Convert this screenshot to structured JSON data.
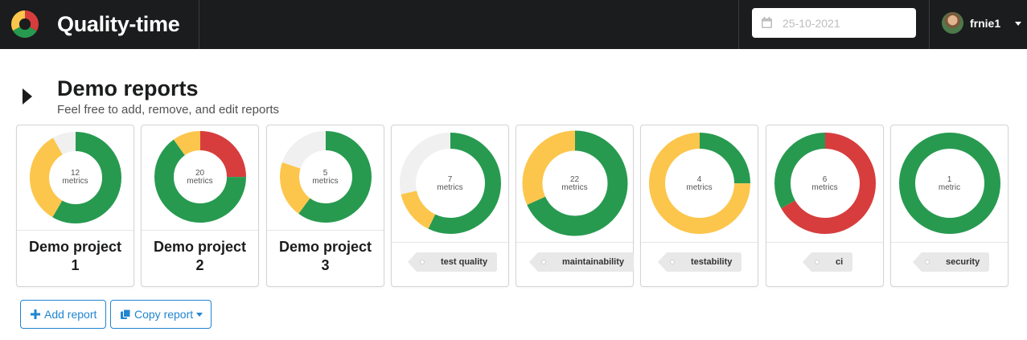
{
  "app": {
    "title": "Quality-time",
    "logo_icon": "quality-time-logo-icon"
  },
  "date_picker": {
    "value": "25-10-2021",
    "icon": "calendar-icon"
  },
  "user": {
    "name": "frnie1",
    "avatar_icon": "user-avatar",
    "caret_icon": "caret-down-icon"
  },
  "page": {
    "title": "Demo reports",
    "subtitle": "Feel free to add, remove, and edit reports",
    "collapse_icon": "caret-right-icon"
  },
  "colors": {
    "green": "#279a50",
    "yellow": "#fcc64c",
    "red": "#d73d3d",
    "grey": "#f0f0f0",
    "link_blue": "#2185d0",
    "topbar": "#1b1c1d"
  },
  "reports": [
    {
      "name_line1": "Demo project",
      "name_line2": "1",
      "metrics_count": "12",
      "metrics_label": "metrics",
      "segments": [
        {
          "status": "green",
          "count": 7
        },
        {
          "status": "yellow",
          "count": 4
        },
        {
          "status": "grey",
          "count": 1
        }
      ]
    },
    {
      "name_line1": "Demo project",
      "name_line2": "2",
      "metrics_count": "20",
      "metrics_label": "metrics",
      "segments": [
        {
          "status": "red",
          "count": 5
        },
        {
          "status": "green",
          "count": 13
        },
        {
          "status": "yellow",
          "count": 2
        }
      ]
    },
    {
      "name_line1": "Demo project",
      "name_line2": "3",
      "metrics_count": "5",
      "metrics_label": "metrics",
      "segments": [
        {
          "status": "green",
          "count": 3
        },
        {
          "status": "yellow",
          "count": 1
        },
        {
          "status": "grey",
          "count": 1
        }
      ]
    }
  ],
  "tags": [
    {
      "label": "test quality",
      "metrics_count": "7",
      "metrics_label": "metrics",
      "segments": [
        {
          "status": "green",
          "count": 4
        },
        {
          "status": "yellow",
          "count": 1
        },
        {
          "status": "grey",
          "count": 2
        }
      ]
    },
    {
      "label": "maintainability",
      "metrics_count": "22",
      "metrics_label": "metrics",
      "segments": [
        {
          "status": "green",
          "count": 15
        },
        {
          "status": "yellow",
          "count": 7
        }
      ]
    },
    {
      "label": "testability",
      "metrics_count": "4",
      "metrics_label": "metrics",
      "segments": [
        {
          "status": "green",
          "count": 1
        },
        {
          "status": "yellow",
          "count": 3
        }
      ]
    },
    {
      "label": "ci",
      "metrics_count": "6",
      "metrics_label": "metrics",
      "segments": [
        {
          "status": "red",
          "count": 4
        },
        {
          "status": "green",
          "count": 2
        }
      ]
    },
    {
      "label": "security",
      "metrics_count": "1",
      "metrics_label": "metric",
      "segments": [
        {
          "status": "green",
          "count": 1
        }
      ]
    }
  ],
  "actions": {
    "add_report_label": "Add report",
    "add_icon": "plus-icon",
    "copy_report_label": "Copy report",
    "copy_icon": "copy-icon"
  }
}
